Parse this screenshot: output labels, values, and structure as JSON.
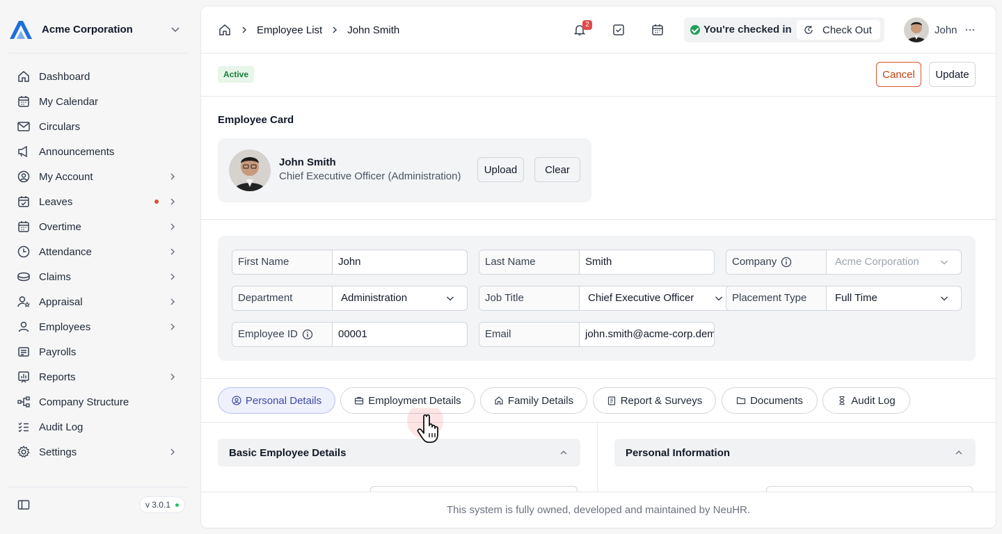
{
  "sidebar": {
    "org_name": "Acme Corporation",
    "items": [
      {
        "label": "Dashboard",
        "icon": "home-icon"
      },
      {
        "label": "My Calendar",
        "icon": "calendar-icon"
      },
      {
        "label": "Circulars",
        "icon": "mail-icon"
      },
      {
        "label": "Announcements",
        "icon": "megaphone-icon"
      },
      {
        "label": "My Account",
        "icon": "user-circle-icon"
      },
      {
        "label": "Leaves",
        "icon": "calendar-check-icon"
      },
      {
        "label": "Overtime",
        "icon": "calendar-clock-icon"
      },
      {
        "label": "Attendance",
        "icon": "clock-icon"
      },
      {
        "label": "Claims",
        "icon": "coins-icon"
      },
      {
        "label": "Appraisal",
        "icon": "user-star-icon"
      },
      {
        "label": "Employees",
        "icon": "user-icon"
      },
      {
        "label": "Payrolls",
        "icon": "receipt-icon"
      },
      {
        "label": "Reports",
        "icon": "chart-icon"
      },
      {
        "label": "Company Structure",
        "icon": "structure-icon"
      },
      {
        "label": "Audit Log",
        "icon": "list-check-icon"
      },
      {
        "label": "Settings",
        "icon": "gear-icon"
      }
    ],
    "version": "v 3.0.1"
  },
  "header": {
    "breadcrumb": [
      "Employee List",
      "John Smith"
    ],
    "notification_count": "2",
    "checkin_status": "You're checked in",
    "checkout_label": "Check Out",
    "user_name": "John"
  },
  "status": {
    "badge": "Active",
    "cancel_label": "Cancel",
    "update_label": "Update"
  },
  "card": {
    "title": "Employee Card",
    "name": "John Smith",
    "role": "Chief Executive Officer (Administration)",
    "upload_label": "Upload",
    "clear_label": "Clear"
  },
  "form": {
    "first_name_label": "First Name",
    "first_name": "John",
    "last_name_label": "Last Name",
    "last_name": "Smith",
    "company_label": "Company",
    "company": "Acme Corporation",
    "department_label": "Department",
    "department": "Administration",
    "job_title_label": "Job Title",
    "job_title": "Chief Executive Officer",
    "placement_type_label": "Placement Type",
    "placement_type": "Full Time",
    "employee_id_label": "Employee ID",
    "employee_id": "00001",
    "email_label": "Email",
    "email": "john.smith@acme-corp.demo"
  },
  "tabs": [
    {
      "label": "Personal Details",
      "icon": "user-circle-icon",
      "active": true
    },
    {
      "label": "Employment Details",
      "icon": "briefcase-icon",
      "active": false
    },
    {
      "label": "Family Details",
      "icon": "home-icon",
      "active": false
    },
    {
      "label": "Report & Surveys",
      "icon": "clipboard-icon",
      "active": false
    },
    {
      "label": "Documents",
      "icon": "folder-icon",
      "active": false
    },
    {
      "label": "Audit Log",
      "icon": "hourglass-icon",
      "active": false
    }
  ],
  "sections": {
    "left": "Basic Employee Details",
    "right": "Personal Information"
  },
  "footer": "This system is fully owned, developed and maintained by NeuHR.",
  "colors": {
    "accent": "#3f4aa6",
    "danger": "#d9532c",
    "success": "#22a05a",
    "logo": "#1e6fd9"
  }
}
